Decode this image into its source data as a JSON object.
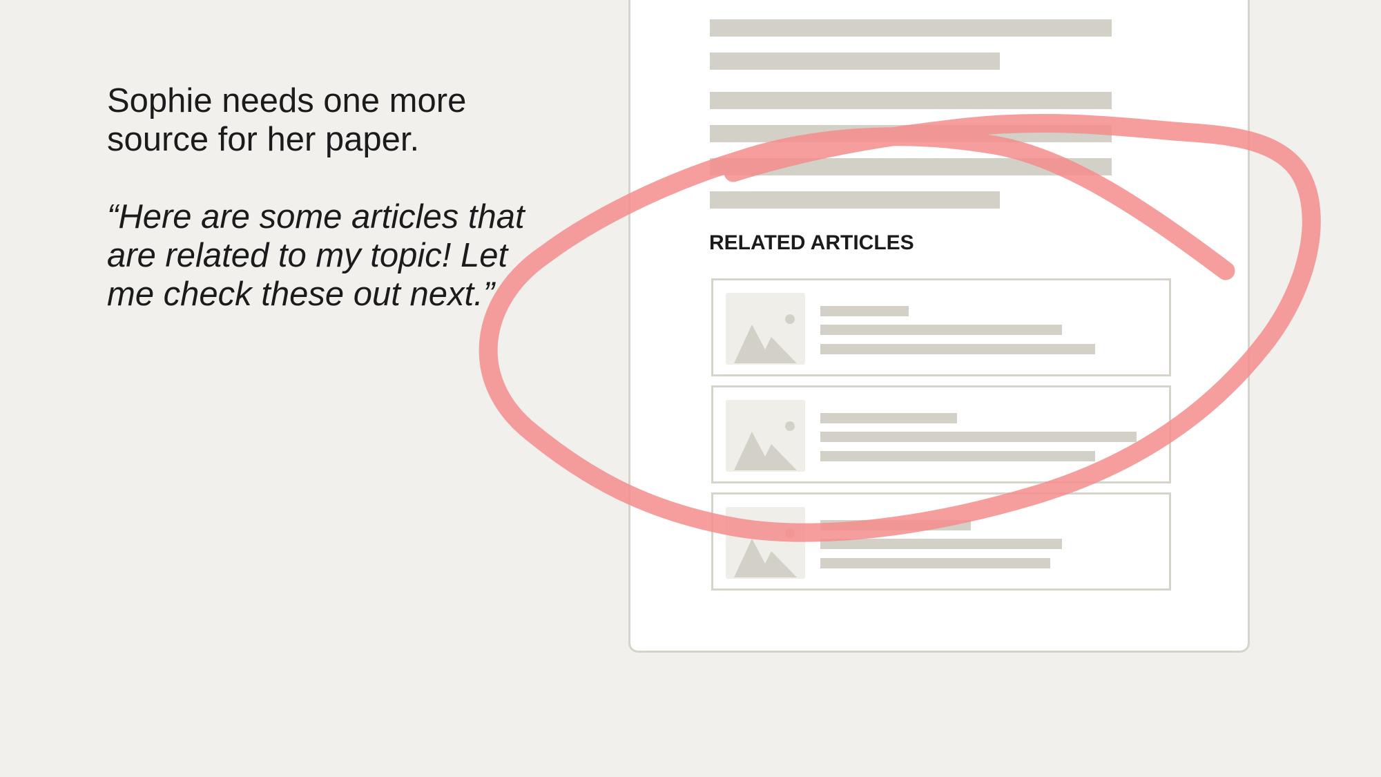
{
  "narrative": {
    "intro": "Sophie needs one more source for her paper.",
    "quote": "“Here are some articles that are related to my topic! Let me check these out next.”"
  },
  "related_articles": {
    "heading": "RELATED ARTICLES",
    "items": [
      {
        "thumbnail_icon": "image-placeholder-icon"
      },
      {
        "thumbnail_icon": "image-placeholder-icon"
      },
      {
        "thumbnail_icon": "image-placeholder-icon"
      }
    ]
  },
  "colors": {
    "background": "#f1f0ec",
    "placeholder": "#d3d0c8",
    "highlight": "#f48d8d",
    "text": "#1b1b1b"
  }
}
